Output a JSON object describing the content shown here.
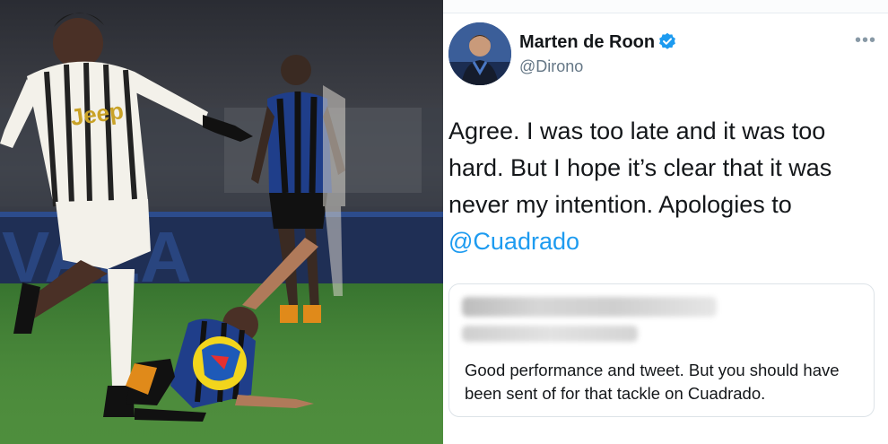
{
  "photo": {
    "board_letters": "VALA",
    "shirt_text": "Jeep"
  },
  "tweet": {
    "author_name": "Marten de Roon",
    "author_handle": "@Dirono",
    "more_label": "•••",
    "verified_icon": "verified-badge-icon",
    "body_text": "Agree. I was too late and it was too hard. But I hope it’s clear that it was never my intention. Apologies to",
    "body_mention": "@Cuadrado",
    "accent_color": "#1d9bf0",
    "quoted": {
      "text": "Good performance and tweet. But you should have been sent of for that tackle on Cuadrado."
    }
  }
}
